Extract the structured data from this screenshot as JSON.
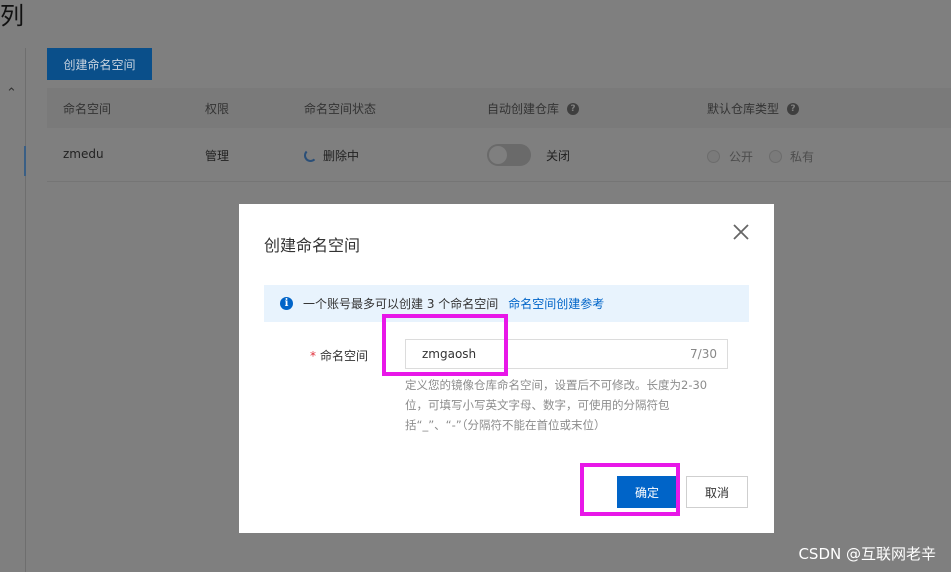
{
  "page": {
    "title": "列"
  },
  "toolbar": {
    "create_button_label": "创建命名空间"
  },
  "table": {
    "columns": [
      "命名空间",
      "权限",
      "命名空间状态",
      "自动创建仓库",
      "默认仓库类型"
    ],
    "row": {
      "namespace": "zmedu",
      "permission": "管理",
      "status": "删除中",
      "auto_create_label": "关闭",
      "repo_type_options": [
        "公开",
        "私有"
      ]
    }
  },
  "modal": {
    "title": "创建命名空间",
    "notice_text": "一个账号最多可以创建 3 个命名空间",
    "notice_link": "命名空间创建参考",
    "field_label": "命名空间",
    "input_value": "zmgaosh",
    "counter": "7/30",
    "hint": "定义您的镜像仓库命名空间，设置后不可修改。长度为2-30位，可填写小写英文字母、数字，可使用的分隔符包括“_”、“-”（分隔符不能在首位或末位）",
    "confirm_label": "确定",
    "cancel_label": "取消"
  },
  "watermark": "CSDN @互联网老辛",
  "colors": {
    "primary": "#0064c8",
    "highlight": "#e817e8",
    "notice_bg": "#e8f3fd"
  }
}
